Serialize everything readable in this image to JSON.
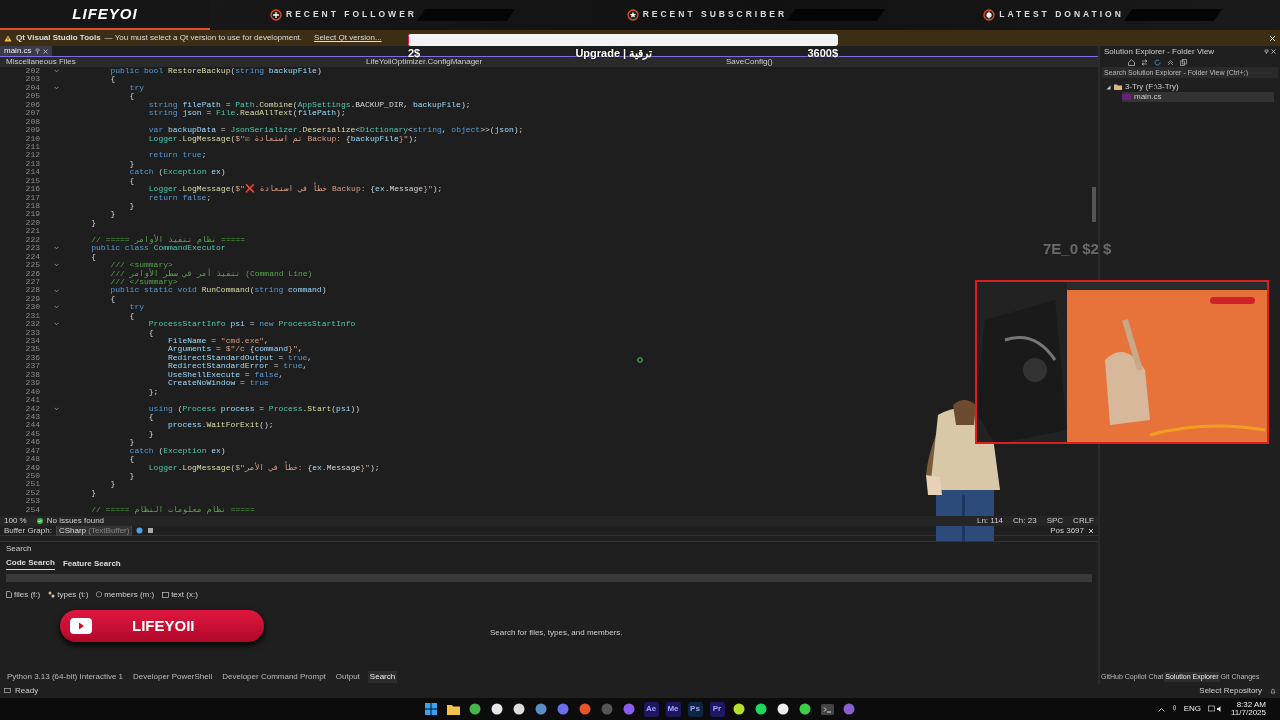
{
  "overlay": {
    "logo": "LIFEYOI",
    "sections": [
      {
        "kind": "plus",
        "label": "RECENT FOLLOWER"
      },
      {
        "kind": "star",
        "label": "RECENT SUBSCRIBER"
      },
      {
        "kind": "coin",
        "label": "LATEST DONATION"
      }
    ],
    "goal": {
      "start": "2$",
      "title": "Upgrade | ترقية",
      "target": "3600$",
      "level": 0.002
    },
    "faded_text": "7E_0 $2 $",
    "youtube_button": {
      "label": "LIFEYOII"
    }
  },
  "infobar": {
    "title": "Qt Visual Studio Tools",
    "message": "— You must select a Qt version to use for development.",
    "link": "Select Qt version..."
  },
  "editor": {
    "tabs": [
      {
        "label": "main.cs",
        "selected": true
      }
    ],
    "nav": [
      "Miscellaneous Files",
      "LifeYoiiOptimizer.ConfigManager",
      "SaveConfig()"
    ],
    "lines": [
      {
        "n": "202",
        "foldable": true,
        "code": [
          {
            "text": "        public bool ",
            "kind": "kw"
          },
          {
            "text": "RestoreBackup",
            "kind": "fn"
          },
          {
            "text": "(",
            "kind": "txt"
          },
          {
            "text": "string ",
            "kind": "kw"
          },
          {
            "text": "backupFile",
            "kind": "id"
          },
          {
            "text": ")",
            "kind": "txt"
          }
        ]
      },
      {
        "n": "203",
        "foldable": false,
        "code": [
          {
            "text": "        {",
            "kind": "txt"
          }
        ]
      },
      {
        "n": "204",
        "foldable": true,
        "code": [
          {
            "text": "            try",
            "kind": "kw"
          }
        ]
      },
      {
        "n": "205",
        "foldable": false,
        "code": [
          {
            "text": "            {",
            "kind": "txt"
          }
        ]
      },
      {
        "n": "206",
        "foldable": false,
        "code": [
          {
            "text": "                string ",
            "kind": "kw"
          },
          {
            "text": "filePath",
            "kind": "id"
          },
          {
            "text": " = ",
            "kind": "txt"
          },
          {
            "text": "Path",
            "kind": "type"
          },
          {
            "text": ".",
            "kind": "txt"
          },
          {
            "text": "Combine",
            "kind": "fn"
          },
          {
            "text": "(",
            "kind": "txt"
          },
          {
            "text": "AppSettings",
            "kind": "type"
          },
          {
            "text": ".BACKUP_DIR, ",
            "kind": "txt"
          },
          {
            "text": "backupFile",
            "kind": "id"
          },
          {
            "text": ");",
            "kind": "txt"
          }
        ]
      },
      {
        "n": "207",
        "foldable": false,
        "code": [
          {
            "text": "                string ",
            "kind": "kw"
          },
          {
            "text": "json",
            "kind": "id"
          },
          {
            "text": " = ",
            "kind": "txt"
          },
          {
            "text": "File",
            "kind": "type"
          },
          {
            "text": ".",
            "kind": "txt"
          },
          {
            "text": "ReadAllText",
            "kind": "fn"
          },
          {
            "text": "(",
            "kind": "txt"
          },
          {
            "text": "filePath",
            "kind": "id"
          },
          {
            "text": ");",
            "kind": "txt"
          }
        ]
      },
      {
        "n": "208",
        "foldable": false
      },
      {
        "n": "209",
        "foldable": false,
        "code": [
          {
            "text": "                var ",
            "kind": "kw"
          },
          {
            "text": "backupData",
            "kind": "id"
          },
          {
            "text": " = ",
            "kind": "txt"
          },
          {
            "text": "JsonSerializer",
            "kind": "type"
          },
          {
            "text": ".",
            "kind": "txt"
          },
          {
            "text": "Deserialize",
            "kind": "fn"
          },
          {
            "text": "<",
            "kind": "txt"
          },
          {
            "text": "Dictionary",
            "kind": "type"
          },
          {
            "text": "<",
            "kind": "txt"
          },
          {
            "text": "string",
            "kind": "kw"
          },
          {
            "text": ", ",
            "kind": "txt"
          },
          {
            "text": "object",
            "kind": "kw"
          },
          {
            "text": ">>(",
            "kind": "txt"
          },
          {
            "text": "json",
            "kind": "id"
          },
          {
            "text": ");",
            "kind": "txt"
          }
        ]
      },
      {
        "n": "210",
        "foldable": false,
        "code": [
          {
            "text": "                Logger",
            "kind": "type"
          },
          {
            "text": ".",
            "kind": "txt"
          },
          {
            "text": "LogMessage",
            "kind": "fn"
          },
          {
            "text": "(",
            "kind": "txt"
          },
          {
            "text": "$\"☑ تم استعادة Backup: ",
            "kind": "str"
          },
          {
            "text": "{",
            "kind": "txt"
          },
          {
            "text": "backupFile",
            "kind": "id"
          },
          {
            "text": "}\"",
            "kind": "str"
          },
          {
            "text": ");",
            "kind": "txt"
          }
        ]
      },
      {
        "n": "211",
        "foldable": false
      },
      {
        "n": "212",
        "foldable": false,
        "code": [
          {
            "text": "                return true",
            "kind": "kw"
          },
          {
            "text": ";",
            "kind": "txt"
          }
        ]
      },
      {
        "n": "213",
        "foldable": false,
        "code": [
          {
            "text": "            }",
            "kind": "txt"
          }
        ]
      },
      {
        "n": "214",
        "foldable": false,
        "code": [
          {
            "text": "            catch ",
            "kind": "kw"
          },
          {
            "text": "(",
            "kind": "txt"
          },
          {
            "text": "Exception ",
            "kind": "type"
          },
          {
            "text": "ex",
            "kind": "id"
          },
          {
            "text": ")",
            "kind": "txt"
          }
        ]
      },
      {
        "n": "215",
        "foldable": false,
        "code": [
          {
            "text": "            {",
            "kind": "txt"
          }
        ]
      },
      {
        "n": "216",
        "foldable": false,
        "code": [
          {
            "text": "                Logger",
            "kind": "type"
          },
          {
            "text": ".",
            "kind": "txt"
          },
          {
            "text": "LogMessage",
            "kind": "fn"
          },
          {
            "text": "(",
            "kind": "txt"
          },
          {
            "text": "$\"❌ خطأ في استعادة Backup: ",
            "kind": "str"
          },
          {
            "text": "{",
            "kind": "txt"
          },
          {
            "text": "ex",
            "kind": "id"
          },
          {
            "text": ".Message",
            "kind": "txt"
          },
          {
            "text": "}\"",
            "kind": "str"
          },
          {
            "text": ");",
            "kind": "txt"
          }
        ]
      },
      {
        "n": "217",
        "foldable": false,
        "code": [
          {
            "text": "                return false",
            "kind": "kw"
          },
          {
            "text": ";",
            "kind": "txt"
          }
        ]
      },
      {
        "n": "218",
        "foldable": false,
        "code": [
          {
            "text": "            }",
            "kind": "txt"
          }
        ]
      },
      {
        "n": "219",
        "foldable": false,
        "code": [
          {
            "text": "        }",
            "kind": "txt"
          }
        ]
      },
      {
        "n": "220",
        "foldable": false,
        "code": [
          {
            "text": "    }",
            "kind": "txt"
          }
        ]
      },
      {
        "n": "221",
        "foldable": false
      },
      {
        "n": "222",
        "foldable": false,
        "code": [
          {
            "text": "    // ===== نظام تنفيذ الأوامر =====",
            "kind": "com"
          }
        ]
      },
      {
        "n": "223",
        "foldable": true,
        "code": [
          {
            "text": "    public class ",
            "kind": "kw"
          },
          {
            "text": "CommandExecutor",
            "kind": "type"
          }
        ]
      },
      {
        "n": "224",
        "foldable": false,
        "code": [
          {
            "text": "    {",
            "kind": "txt"
          }
        ]
      },
      {
        "n": "225",
        "foldable": true,
        "code": [
          {
            "text": "        /// <summary>",
            "kind": "com"
          }
        ]
      },
      {
        "n": "226",
        "foldable": false,
        "code": [
          {
            "text": "        /// تنفيذ أمر في سطر الأوامر (Command Line)",
            "kind": "com"
          }
        ]
      },
      {
        "n": "227",
        "foldable": false,
        "code": [
          {
            "text": "        /// </summary>",
            "kind": "com"
          }
        ]
      },
      {
        "n": "228",
        "foldable": true,
        "code": [
          {
            "text": "        public static void ",
            "kind": "kw"
          },
          {
            "text": "RunCommand",
            "kind": "fn"
          },
          {
            "text": "(",
            "kind": "txt"
          },
          {
            "text": "string ",
            "kind": "kw"
          },
          {
            "text": "command",
            "kind": "id"
          },
          {
            "text": ")",
            "kind": "txt"
          }
        ]
      },
      {
        "n": "229",
        "foldable": false,
        "code": [
          {
            "text": "        {",
            "kind": "txt"
          }
        ]
      },
      {
        "n": "230",
        "foldable": true,
        "code": [
          {
            "text": "            try",
            "kind": "kw"
          }
        ]
      },
      {
        "n": "231",
        "foldable": false,
        "code": [
          {
            "text": "            {",
            "kind": "txt"
          }
        ]
      },
      {
        "n": "232",
        "foldable": true,
        "code": [
          {
            "text": "                ProcessStartInfo ",
            "kind": "type"
          },
          {
            "text": "psi",
            "kind": "id"
          },
          {
            "text": " = ",
            "kind": "txt"
          },
          {
            "text": "new ",
            "kind": "kw"
          },
          {
            "text": "ProcessStartInfo",
            "kind": "type"
          }
        ]
      },
      {
        "n": "233",
        "foldable": false,
        "code": [
          {
            "text": "                {",
            "kind": "txt"
          }
        ]
      },
      {
        "n": "234",
        "foldable": false,
        "code": [
          {
            "text": "                    FileName",
            "kind": "id"
          },
          {
            "text": " = ",
            "kind": "txt"
          },
          {
            "text": "\"cmd.exe\"",
            "kind": "str"
          },
          {
            "text": ",",
            "kind": "txt"
          }
        ]
      },
      {
        "n": "235",
        "foldable": false,
        "code": [
          {
            "text": "                    Arguments",
            "kind": "id"
          },
          {
            "text": " = ",
            "kind": "txt"
          },
          {
            "text": "$\"/c ",
            "kind": "str"
          },
          {
            "text": "{",
            "kind": "txt"
          },
          {
            "text": "command",
            "kind": "id"
          },
          {
            "text": "}\"",
            "kind": "str"
          },
          {
            "text": ",",
            "kind": "txt"
          }
        ]
      },
      {
        "n": "236",
        "foldable": false,
        "code": [
          {
            "text": "                    RedirectStandardOutput",
            "kind": "id"
          },
          {
            "text": " = ",
            "kind": "txt"
          },
          {
            "text": "true",
            "kind": "kw"
          },
          {
            "text": ",",
            "kind": "txt"
          }
        ]
      },
      {
        "n": "237",
        "foldable": false,
        "code": [
          {
            "text": "                    RedirectStandardError",
            "kind": "id"
          },
          {
            "text": " = ",
            "kind": "txt"
          },
          {
            "text": "true",
            "kind": "kw"
          },
          {
            "text": ",",
            "kind": "txt"
          }
        ]
      },
      {
        "n": "238",
        "foldable": false,
        "code": [
          {
            "text": "                    UseShellExecute",
            "kind": "id"
          },
          {
            "text": " = ",
            "kind": "txt"
          },
          {
            "text": "false",
            "kind": "kw"
          },
          {
            "text": ",",
            "kind": "txt"
          }
        ]
      },
      {
        "n": "239",
        "foldable": false,
        "code": [
          {
            "text": "                    CreateNoWindow",
            "kind": "id"
          },
          {
            "text": " = ",
            "kind": "txt"
          },
          {
            "text": "true",
            "kind": "kw"
          }
        ]
      },
      {
        "n": "240",
        "foldable": false,
        "code": [
          {
            "text": "                };",
            "kind": "txt"
          }
        ]
      },
      {
        "n": "241",
        "foldable": false
      },
      {
        "n": "242",
        "foldable": true,
        "code": [
          {
            "text": "                using ",
            "kind": "kw"
          },
          {
            "text": "(",
            "kind": "txt"
          },
          {
            "text": "Process ",
            "kind": "type"
          },
          {
            "text": "process",
            "kind": "id"
          },
          {
            "text": " = ",
            "kind": "txt"
          },
          {
            "text": "Process",
            "kind": "type"
          },
          {
            "text": ".",
            "kind": "txt"
          },
          {
            "text": "Start",
            "kind": "fn"
          },
          {
            "text": "(",
            "kind": "txt"
          },
          {
            "text": "psi",
            "kind": "id"
          },
          {
            "text": "))",
            "kind": "txt"
          }
        ]
      },
      {
        "n": "243",
        "foldable": false,
        "code": [
          {
            "text": "                {",
            "kind": "txt"
          }
        ]
      },
      {
        "n": "244",
        "foldable": false,
        "code": [
          {
            "text": "                    process",
            "kind": "id"
          },
          {
            "text": ".",
            "kind": "txt"
          },
          {
            "text": "WaitForExit",
            "kind": "fn"
          },
          {
            "text": "();",
            "kind": "txt"
          }
        ]
      },
      {
        "n": "245",
        "foldable": false,
        "code": [
          {
            "text": "                }",
            "kind": "txt"
          }
        ]
      },
      {
        "n": "246",
        "foldable": false,
        "code": [
          {
            "text": "            }",
            "kind": "txt"
          }
        ]
      },
      {
        "n": "247",
        "foldable": false,
        "code": [
          {
            "text": "            catch ",
            "kind": "kw"
          },
          {
            "text": "(",
            "kind": "txt"
          },
          {
            "text": "Exception ",
            "kind": "type"
          },
          {
            "text": "ex",
            "kind": "id"
          },
          {
            "text": ")",
            "kind": "txt"
          }
        ]
      },
      {
        "n": "248",
        "foldable": false,
        "code": [
          {
            "text": "            {",
            "kind": "txt"
          }
        ]
      },
      {
        "n": "249",
        "foldable": false,
        "code": [
          {
            "text": "                Logger",
            "kind": "type"
          },
          {
            "text": ".",
            "kind": "txt"
          },
          {
            "text": "LogMessage",
            "kind": "fn"
          },
          {
            "text": "(",
            "kind": "txt"
          },
          {
            "text": "$\"خطأ في الأمر: ",
            "kind": "str"
          },
          {
            "text": "{",
            "kind": "txt"
          },
          {
            "text": "ex",
            "kind": "id"
          },
          {
            "text": ".Message",
            "kind": "txt"
          },
          {
            "text": "}\"",
            "kind": "str"
          },
          {
            "text": ");",
            "kind": "txt"
          }
        ]
      },
      {
        "n": "250",
        "foldable": false,
        "code": [
          {
            "text": "            }",
            "kind": "txt"
          }
        ]
      },
      {
        "n": "251",
        "foldable": false,
        "code": [
          {
            "text": "        }",
            "kind": "txt"
          }
        ]
      },
      {
        "n": "252",
        "foldable": false,
        "code": [
          {
            "text": "    }",
            "kind": "txt"
          }
        ]
      },
      {
        "n": "253",
        "foldable": false
      },
      {
        "n": "254",
        "foldable": false,
        "code": [
          {
            "text": "    // ===== نظام معلومات النظام =====",
            "kind": "com"
          }
        ]
      }
    ],
    "status": {
      "zoom": "100 %",
      "issues": "No issues found",
      "ln": "Ln: 114",
      "ch": "Ch: 23",
      "spc": "SPC",
      "crlf": "CRLF"
    },
    "buffer_graph": {
      "label": "Buffer Graph:",
      "value": "CSharp",
      "hint": "(TextBuffer)",
      "pos": "Pos 3697"
    }
  },
  "search_panel": {
    "title": "Search",
    "tabs": [
      {
        "label": "Code Search",
        "selected": true
      },
      {
        "label": "Feature Search",
        "selected": false
      }
    ],
    "filters": [
      {
        "kind": "file",
        "label": "files (f:)"
      },
      {
        "kind": "type",
        "label": "types (t:)"
      },
      {
        "kind": "member",
        "label": "members (m:)"
      },
      {
        "kind": "text",
        "label": "text (x:)"
      }
    ],
    "empty_message": "Search for files, types, and members."
  },
  "bottom_tabs": [
    {
      "label": "Python 3.13 (64-bit) Interactive 1",
      "selected": false
    },
    {
      "label": "Developer PowerShell",
      "selected": false
    },
    {
      "label": "Developer Command Prompt",
      "selected": false
    },
    {
      "label": "Output",
      "selected": false
    },
    {
      "label": "Search",
      "selected": true
    }
  ],
  "solution_explorer": {
    "title": "Solution Explorer - Folder View",
    "search_placeholder": "Search Solution Explorer - Folder View (Ctrl+;)",
    "tree": [
      {
        "label": "3-Try (F:\\3-Try)",
        "expanded": true,
        "children": [
          {
            "label": "main.cs",
            "selected": true
          }
        ]
      }
    ],
    "tabs": [
      {
        "label": "GitHub Copilot Chat",
        "selected": false
      },
      {
        "label": "Solution Explorer",
        "selected": true
      },
      {
        "label": "Git Changes",
        "selected": false
      }
    ]
  },
  "status_bar": {
    "text": "Ready",
    "repo": "Select Repository"
  },
  "taskbar": {
    "apps": [
      {
        "kind": "start",
        "color": "#3aa0f0"
      },
      {
        "kind": "folder",
        "color": "#f2c14e"
      },
      {
        "kind": "dot",
        "color": "#45b649"
      },
      {
        "kind": "dot",
        "color": "#e8e8e8"
      },
      {
        "kind": "dot",
        "color": "#dddddd"
      },
      {
        "kind": "dot",
        "color": "#5a8fc8"
      },
      {
        "kind": "dot",
        "color": "#6a6ee8"
      },
      {
        "kind": "dot",
        "color": "#e8542c"
      },
      {
        "kind": "dot",
        "color": "#555555"
      },
      {
        "kind": "dot",
        "color": "#8a5cf0"
      },
      {
        "kind": "tile",
        "color": "#1c1760",
        "label": "Ae"
      },
      {
        "kind": "tile",
        "color": "#1c1760",
        "label": "Me"
      },
      {
        "kind": "tile",
        "color": "#0e2740",
        "label": "Ps"
      },
      {
        "kind": "tile",
        "color": "#1c1760",
        "label": "Pr"
      },
      {
        "kind": "dot",
        "color": "#b7e02a"
      },
      {
        "kind": "dot",
        "color": "#1ed760"
      },
      {
        "kind": "dot",
        "color": "#eeeeee"
      },
      {
        "kind": "dot",
        "color": "#3ecf4a"
      },
      {
        "kind": "terminal",
        "color": "#444444"
      },
      {
        "kind": "dot",
        "color": "#8860d0"
      }
    ],
    "lang": "ENG",
    "time": "8:32 AM",
    "date": "11/7/2025"
  }
}
